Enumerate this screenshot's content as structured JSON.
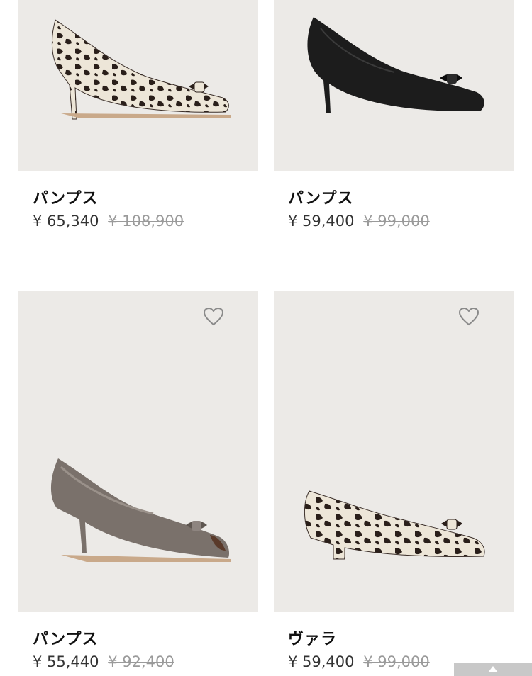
{
  "products": [
    {
      "name": "パンプス",
      "price": "¥ 65,340",
      "original_price": "¥ 108,900",
      "style": "leopard-heel"
    },
    {
      "name": "パンプス",
      "price": "¥ 59,400",
      "original_price": "¥ 99,000",
      "style": "black-heel"
    },
    {
      "name": "パンプス",
      "price": "¥ 55,440",
      "original_price": "¥ 92,400",
      "style": "taupe-peeptoe"
    },
    {
      "name": "ヴァラ",
      "price": "¥ 59,400",
      "original_price": "¥ 99,000",
      "style": "leopard-block"
    }
  ],
  "icons": {
    "favorite": "heart-outline-icon",
    "scroll_top": "arrow-up-icon"
  },
  "colors": {
    "card_background": "#eceae7",
    "strike_price": "#9a9a9a"
  }
}
